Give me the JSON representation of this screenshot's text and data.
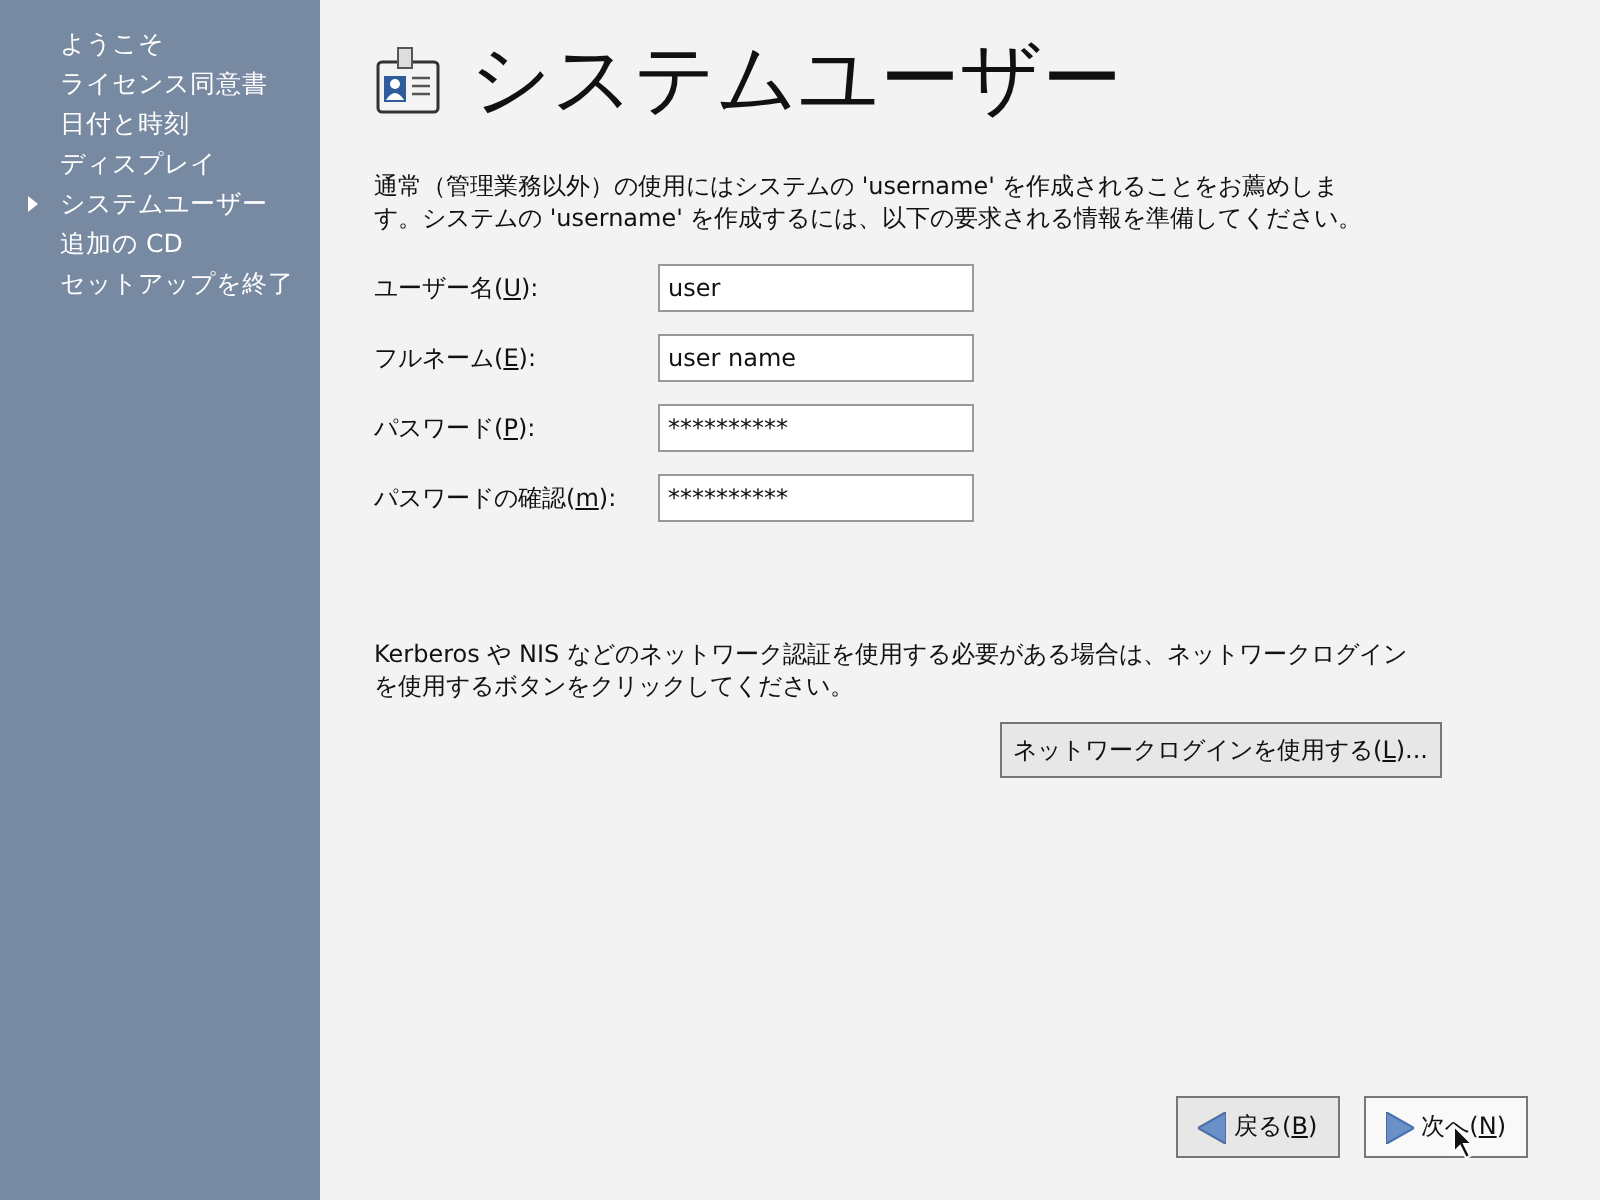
{
  "sidebar": {
    "items": [
      {
        "label": "ようこそ",
        "selected": false
      },
      {
        "label": "ライセンス同意書",
        "selected": false
      },
      {
        "label": "日付と時刻",
        "selected": false
      },
      {
        "label": "ディスプレイ",
        "selected": false
      },
      {
        "label": "システムユーザー",
        "selected": true
      },
      {
        "label": "追加の CD",
        "selected": false
      },
      {
        "label": "セットアップを終了",
        "selected": false
      }
    ]
  },
  "header": {
    "title": "システムユーザー"
  },
  "intro": "通常（管理業務以外）の使用にはシステムの 'username' を作成されることをお薦めします。システムの 'username' を作成するには、以下の要求される情報を準備してください。",
  "fields": [
    {
      "label_before": "ユーザー名(",
      "mnemonic": "U",
      "label_after": "):",
      "value": "user"
    },
    {
      "label_before": "フルネーム(",
      "mnemonic": "E",
      "label_after": "):",
      "value": "user name"
    },
    {
      "label_before": "パスワード(",
      "mnemonic": "P",
      "label_after": "):",
      "value": "**********"
    },
    {
      "label_before": "パスワードの確認(",
      "mnemonic": "m",
      "label_after": "):",
      "value": "**********"
    }
  ],
  "network_note": "Kerberos や NIS などのネットワーク認証を使用する必要がある場合は、ネットワークログインを使用するボタンをクリックしてください。",
  "network_button": {
    "label_before": "ネットワークログインを使用する(",
    "mnemonic": "L",
    "label_after": ")..."
  },
  "nav_buttons": [
    {
      "kind": "back",
      "label_before": "戻る(",
      "mnemonic": "B",
      "label_after": ")"
    },
    {
      "kind": "next",
      "label_before": "次へ(",
      "mnemonic": "N",
      "label_after": ")"
    }
  ]
}
